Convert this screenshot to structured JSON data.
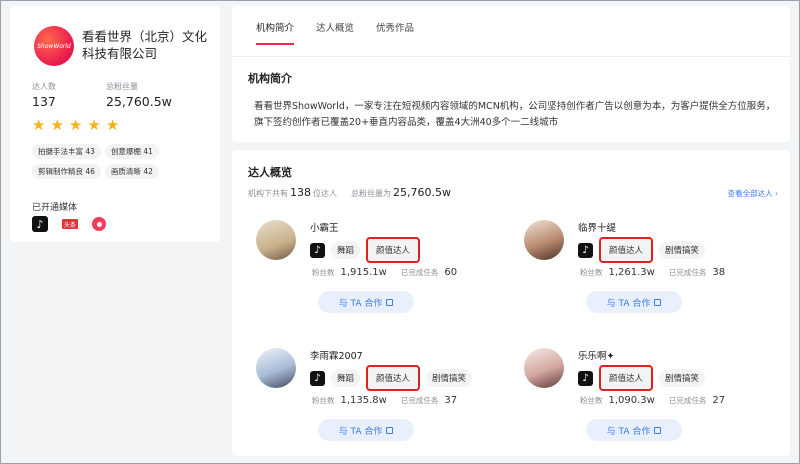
{
  "profile": {
    "logo_text": "ShowWorld",
    "name": "看看世界（北京）文化科技有限公司",
    "stats": [
      {
        "label": "达人数",
        "value": "137"
      },
      {
        "label": "总粉丝量",
        "value": "25,760.5w"
      }
    ],
    "rating": 5,
    "tags": [
      {
        "label": "拍摄手法丰富 43"
      },
      {
        "label": "创意爆棚 41"
      },
      {
        "label": "剪辑制作精良 46"
      },
      {
        "label": "画质清晰 42"
      }
    ],
    "media_title": "已开通媒体",
    "media": {
      "douyin": "♪",
      "toutiao": "头条",
      "xigua": ""
    }
  },
  "tabs": [
    {
      "label": "机构简介",
      "active": true
    },
    {
      "label": "达人概览",
      "active": false
    },
    {
      "label": "优秀作品",
      "active": false
    }
  ],
  "intro": {
    "title": "机构简介",
    "text": "看看世界ShowWorld，一家专注在短视频内容领域的MCN机构，公司坚持创作者广告以创意为本，为客户提供全方位服务，旗下签约创作者已覆盖20+垂直内容品类，覆盖4大洲40多个一二线城市"
  },
  "overview": {
    "title": "达人概览",
    "count_prefix": "机构下共有",
    "count": "138",
    "count_suffix": "位达人",
    "fans_label": "总粉丝量为",
    "fans": "25,760.5w",
    "view_all": "查看全部达人 ›"
  },
  "kols": [
    {
      "name": "小霸王",
      "tags": [
        "舞蹈",
        "颜值达人"
      ],
      "highlight_index": 1,
      "fans_label": "粉丝数",
      "fans": "1,915.1w",
      "tasks_label": "已完成任务",
      "tasks": "60",
      "button": "与 TA 合作",
      "avatar_color": "#c9b08a"
    },
    {
      "name": "临界十缇",
      "tags": [
        "颜值达人",
        "剧情搞笑"
      ],
      "highlight_index": 0,
      "fans_label": "粉丝数",
      "fans": "1,261.3w",
      "tasks_label": "已完成任务",
      "tasks": "38",
      "button": "与 TA 合作",
      "avatar_color": "#b98b6f"
    },
    {
      "name": "李雨霖2007",
      "tags": [
        "舞蹈",
        "颜值达人",
        "剧情搞笑"
      ],
      "highlight_index": 1,
      "fans_label": "粉丝数",
      "fans": "1,135.8w",
      "tasks_label": "已完成任务",
      "tasks": "37",
      "button": "与 TA 合作",
      "avatar_color": "#a9bcd6"
    },
    {
      "name": "乐乐啊✦",
      "tags": [
        "颜值达人",
        "剧情搞笑"
      ],
      "highlight_index": 0,
      "fans_label": "粉丝数",
      "fans": "1,090.3w",
      "tasks_label": "已完成任务",
      "tasks": "27",
      "button": "与 TA 合作",
      "avatar_color": "#d4a7a0"
    }
  ],
  "colors": {
    "accent": "#f0244e",
    "link": "#3b7cf0",
    "star": "#f5b31a",
    "highlight_box": "#e02020"
  }
}
